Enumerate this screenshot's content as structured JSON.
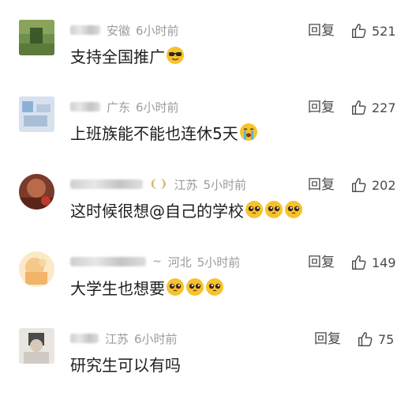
{
  "comments": [
    {
      "region": "安徽",
      "time": "6小时前",
      "text": "支持全国推广",
      "emoji": "sunglasses-emoji",
      "reply_label": "回复",
      "likes": "521"
    },
    {
      "region": "广东",
      "time": "6小时前",
      "text": "上班族能不能也连休5天",
      "emoji": "crying-emoji",
      "reply_label": "回复",
      "likes": "227"
    },
    {
      "region": "江苏",
      "time": "5小时前",
      "text": "这时候很想@自己的学校",
      "emoji": "pleading-emoji",
      "reply_label": "回复",
      "likes": "202"
    },
    {
      "region": "河北",
      "time": "5小时前",
      "text": "大学生也想要",
      "emoji": "pleading-emoji",
      "reply_label": "回复",
      "likes": "149"
    },
    {
      "region": "江苏",
      "time": "6小时前",
      "text": "研究生可以有吗",
      "emoji": "",
      "reply_label": "回复",
      "likes": "75"
    }
  ],
  "colors": {
    "meta_text": "#9b9b9b",
    "body_text": "#1e1e1e",
    "action_text": "#4a4a4a",
    "badge": "#d7b56a"
  }
}
